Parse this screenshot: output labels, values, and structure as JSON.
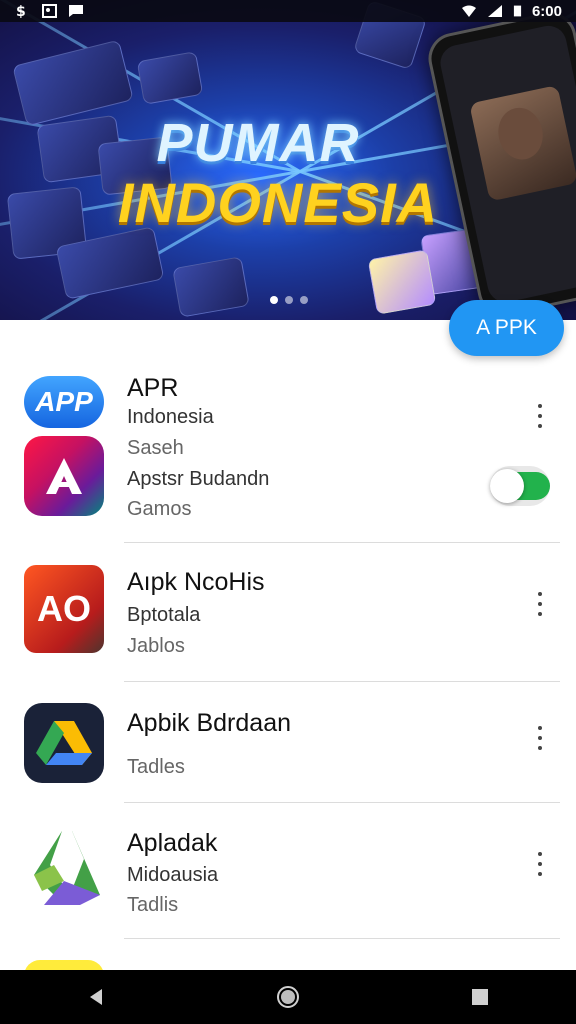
{
  "status_bar": {
    "time": "6:00"
  },
  "banner": {
    "title_line1": "PUMAR",
    "title_line2": "INDONESIA",
    "page_count": 3,
    "active_page": 1
  },
  "fab": {
    "label": "A PPK"
  },
  "apps": [
    {
      "title": "APR",
      "subtitle": "Indonesia",
      "detail": "Saseh",
      "icon_label": "APP",
      "icon_color": "#1e88ff",
      "menu_icon": "more-vert-icon"
    },
    {
      "title": "Apstsr Budandn",
      "subtitle": "Gamos",
      "icon_label": "",
      "icon_color": "#e53935",
      "toggle_on": true
    },
    {
      "title": "Aıpk NcoHis",
      "subtitle": "Bptotala",
      "detail": "Jablos",
      "icon_label": "AO",
      "icon_color": "#d84315",
      "menu_icon": "more-vert-icon"
    },
    {
      "title": "Apbik Bdrdaan",
      "subtitle": "Tadles",
      "icon_label": "",
      "icon_color": "#1a2238",
      "menu_icon": "more-vert-icon"
    },
    {
      "title": "Apladak",
      "subtitle": "Midoausia",
      "detail": "Tadlis",
      "icon_label": "",
      "icon_color": "#2e7d32",
      "menu_icon": "more-vert-icon"
    }
  ],
  "nav": {
    "back": "back-icon",
    "home": "home-icon",
    "recents": "recents-icon"
  }
}
